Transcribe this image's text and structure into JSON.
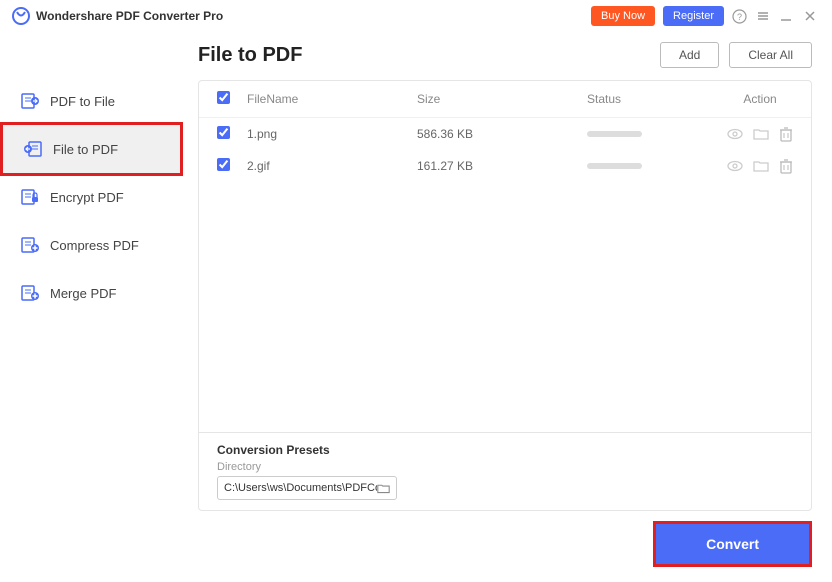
{
  "appTitle": "Wondershare PDF Converter Pro",
  "buyNow": "Buy Now",
  "register": "Register",
  "sidebar": {
    "items": [
      {
        "label": "PDF to File",
        "active": false
      },
      {
        "label": "File to PDF",
        "active": true
      },
      {
        "label": "Encrypt PDF",
        "active": false
      },
      {
        "label": "Compress PDF",
        "active": false
      },
      {
        "label": "Merge PDF",
        "active": false
      }
    ]
  },
  "pageTitle": "File to PDF",
  "addBtn": "Add",
  "clearBtn": "Clear All",
  "table": {
    "headers": {
      "name": "FileName",
      "size": "Size",
      "status": "Status",
      "action": "Action"
    },
    "rows": [
      {
        "checked": true,
        "name": "1.png",
        "size": "586.36 KB"
      },
      {
        "checked": true,
        "name": "2.gif",
        "size": "161.27 KB"
      }
    ]
  },
  "presets": {
    "title": "Conversion Presets",
    "directoryLabel": "Directory",
    "directoryValue": "C:\\Users\\ws\\Documents\\PDFConvert"
  },
  "convertBtn": "Convert"
}
